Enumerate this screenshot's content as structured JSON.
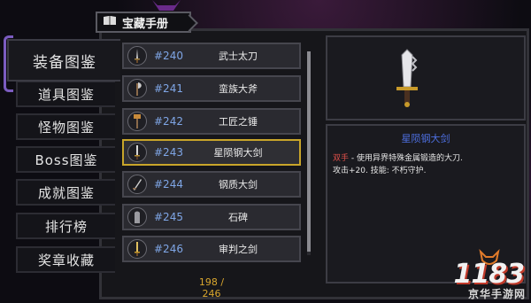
{
  "header": {
    "title": "宝藏手册"
  },
  "tabs": [
    {
      "label": "装备图鉴",
      "active": true
    },
    {
      "label": "道具图鉴",
      "active": false
    },
    {
      "label": "怪物图鉴",
      "active": false
    },
    {
      "label": "Boss图鉴",
      "active": false
    },
    {
      "label": "成就图鉴",
      "active": false
    },
    {
      "label": "排行榜",
      "active": false
    },
    {
      "label": "奖章收藏",
      "active": false
    }
  ],
  "items": [
    {
      "number": "#240",
      "name": "武士太刀",
      "icon": "katana-icon",
      "selected": false
    },
    {
      "number": "#241",
      "name": "蛮族大斧",
      "icon": "axe-icon",
      "selected": false
    },
    {
      "number": "#242",
      "name": "工匠之锤",
      "icon": "hammer-icon",
      "selected": false
    },
    {
      "number": "#243",
      "name": "星陨钢大剑",
      "icon": "greatsword-icon",
      "selected": true
    },
    {
      "number": "#244",
      "name": "钢质大剑",
      "icon": "sword-icon",
      "selected": false
    },
    {
      "number": "#245",
      "name": "石碑",
      "icon": "tablet-icon",
      "selected": false
    },
    {
      "number": "#246",
      "name": "审判之剑",
      "icon": "judgement-sword-icon",
      "selected": false
    }
  ],
  "collection": {
    "count": "198 / 246"
  },
  "detail": {
    "name": "星陨钢大剑",
    "tag": "双手",
    "description_line1": " - 使用异界特殊金属锻造的大刀.",
    "description_line2": "攻击+20. 技能: 不朽守护."
  },
  "watermark": {
    "logo": "1183",
    "subtitle": "京华手游网"
  },
  "colors": {
    "selected_border": "#c8a52a",
    "item_number": "#7fa6e6",
    "item_name_detail": "#4d6fe0",
    "tag_red": "#e0504a",
    "count": "#d9a62e"
  }
}
